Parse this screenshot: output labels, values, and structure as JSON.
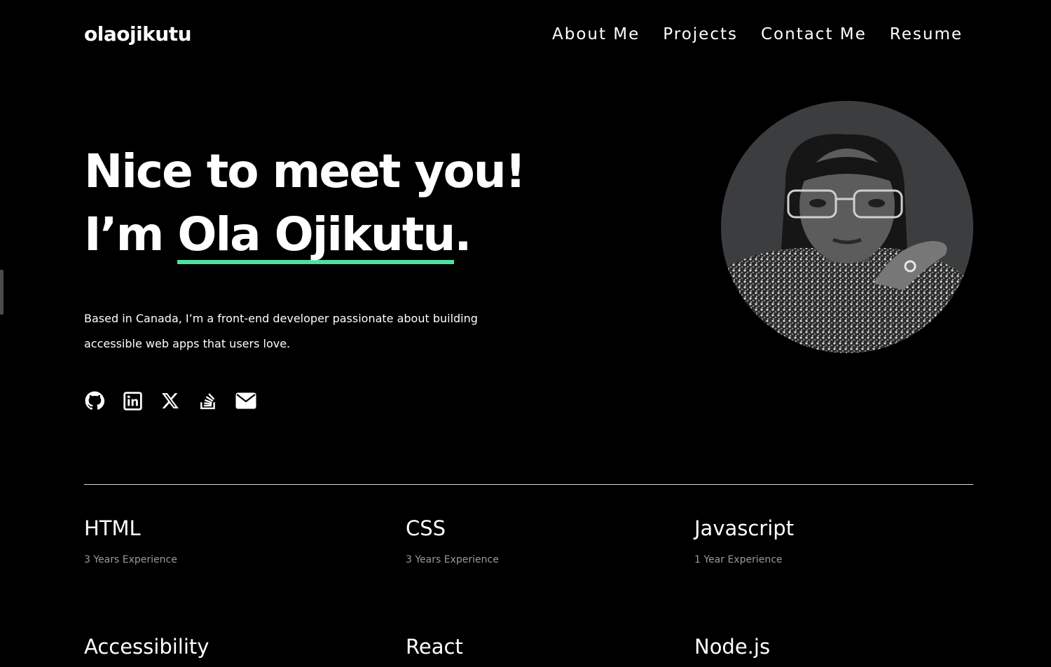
{
  "header": {
    "logo": "olaojikutu",
    "nav": [
      "About Me",
      "Projects",
      "Contact Me",
      "Resume"
    ]
  },
  "hero": {
    "line1": "Nice to meet you!",
    "line2_prefix": "I’m ",
    "name": "Ola Ojikutu",
    "line2_suffix": ".",
    "description": "Based in Canada, I’m a front-end developer passionate about building accessible web apps that users love."
  },
  "socials": [
    {
      "icon": "github-icon"
    },
    {
      "icon": "linkedin-icon"
    },
    {
      "icon": "x-twitter-icon"
    },
    {
      "icon": "stackoverflow-icon"
    },
    {
      "icon": "email-icon"
    }
  ],
  "skills": [
    {
      "name": "HTML",
      "experience": "3 Years Experience"
    },
    {
      "name": "CSS",
      "experience": "3 Years Experience"
    },
    {
      "name": "Javascript",
      "experience": "1 Year Experience"
    },
    {
      "name": "Accessibility",
      "experience": ""
    },
    {
      "name": "React",
      "experience": ""
    },
    {
      "name": "Node.js",
      "experience": ""
    }
  ],
  "colors": {
    "background": "#000000",
    "accent": "#4ee1a0",
    "muted_text": "#9a9a9a"
  }
}
